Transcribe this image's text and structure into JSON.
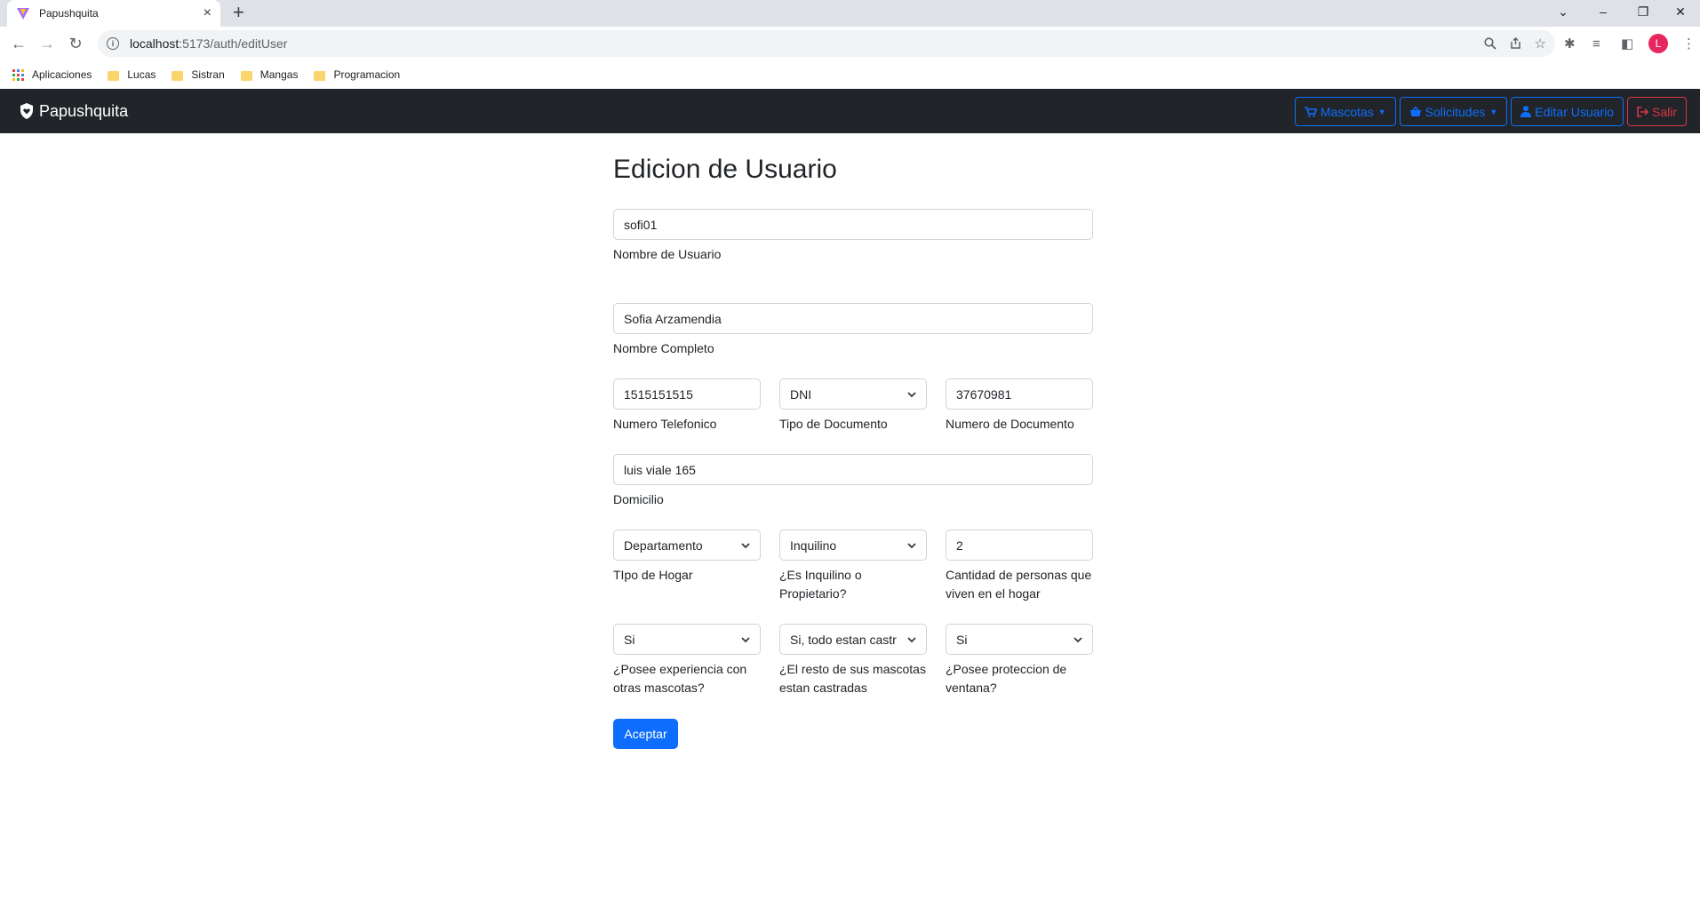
{
  "browser": {
    "tab_title": "Papushquita",
    "tab_close": "×",
    "new_tab": "+",
    "url_host": "localhost",
    "url_path": ":5173/auth/editUser",
    "avatar_letter": "L",
    "window_controls": [
      "⌄",
      "–",
      "❐",
      "✕"
    ],
    "bookmarks": [
      {
        "label": "Aplicaciones",
        "icon": "apps-icon"
      },
      {
        "label": "Lucas",
        "icon": "folder-icon"
      },
      {
        "label": "Sistran",
        "icon": "folder-icon"
      },
      {
        "label": "Mangas",
        "icon": "folder-icon"
      },
      {
        "label": "Programacion",
        "icon": "folder-icon"
      }
    ]
  },
  "navbar": {
    "brand": "Papushquita",
    "buttons": [
      {
        "label": "Mascotas",
        "icon": "cart-icon",
        "dropdown": true,
        "color": "#0d6efd"
      },
      {
        "label": "Solicitudes",
        "icon": "basket-icon",
        "dropdown": true,
        "color": "#0d6efd"
      },
      {
        "label": "Editar Usuario",
        "icon": "user-icon",
        "dropdown": false,
        "color": "#0d6efd"
      },
      {
        "label": "Salir",
        "icon": "sign-out-icon",
        "dropdown": false,
        "color": "#dc3545"
      }
    ]
  },
  "form": {
    "title": "Edicion de Usuario",
    "username": {
      "value": "sofi01",
      "label": "Nombre de Usuario"
    },
    "fullname": {
      "value": "Sofia Arzamendia",
      "label": "Nombre Completo"
    },
    "phone": {
      "value": "1515151515",
      "label": "Numero Telefonico"
    },
    "doc_type": {
      "value": "DNI",
      "label": "Tipo de Documento"
    },
    "doc_number": {
      "value": "37670981",
      "label": "Numero de Documento"
    },
    "address": {
      "value": "luis viale 165",
      "label": "Domicilio"
    },
    "home_type": {
      "value": "Departamento",
      "label": "TIpo de Hogar"
    },
    "tenant": {
      "value": "Inquilino",
      "label": "¿Es Inquilino o Propietario?"
    },
    "people": {
      "value": "2",
      "label": "Cantidad de personas que viven en el hogar"
    },
    "experience": {
      "value": "Si",
      "label": "¿Posee experiencia con otras mascotas?"
    },
    "castrated": {
      "value": "Si, todo estan castr",
      "label": "¿El resto de sus mascotas estan castradas"
    },
    "window_protection": {
      "value": "Si",
      "label": "¿Posee proteccion de ventana?"
    },
    "submit_label": "Aceptar"
  }
}
